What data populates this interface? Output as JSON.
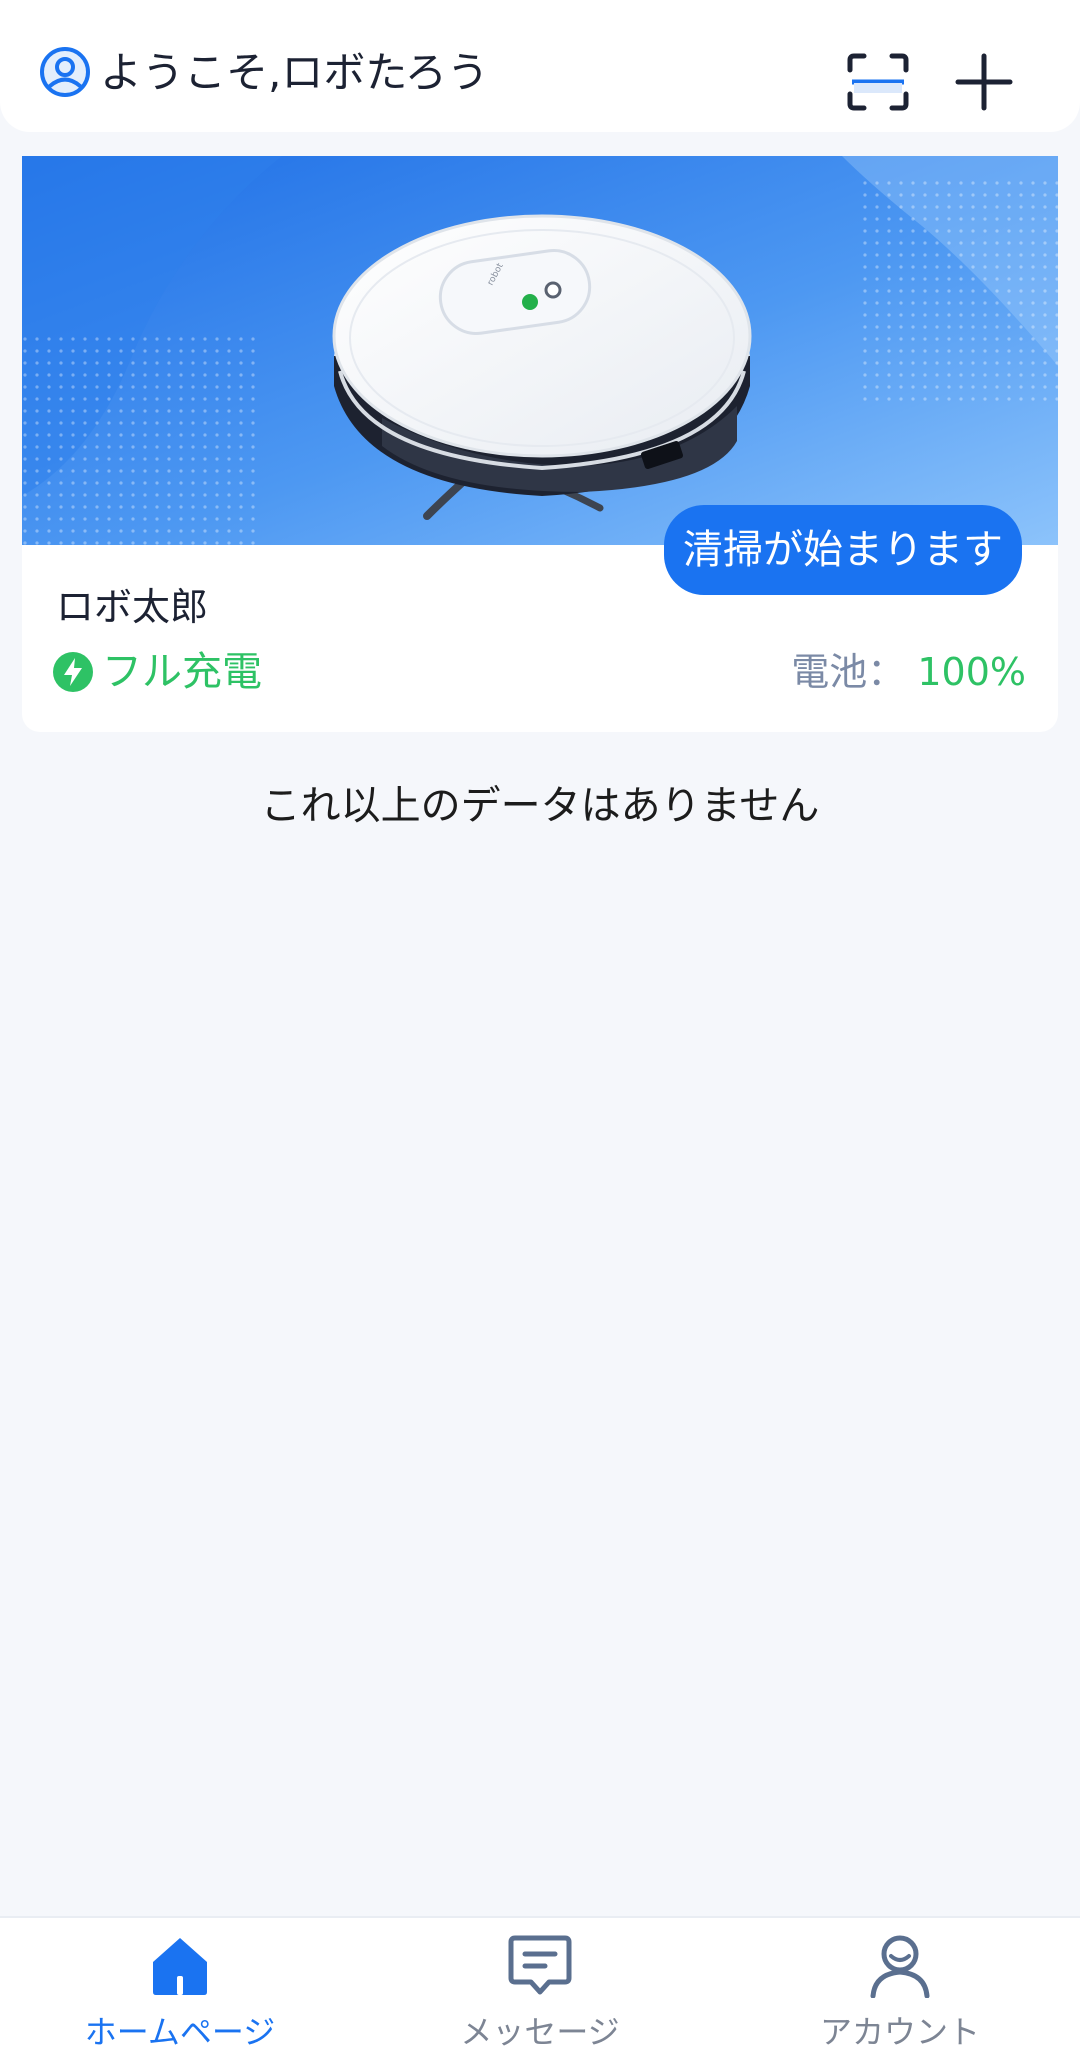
{
  "header": {
    "welcome_text": "ようこそ,ロボたろう",
    "icons": [
      "user-circle-icon",
      "scan-icon",
      "plus-icon"
    ]
  },
  "device": {
    "name": "ロボ太郎",
    "start_button_label": "清掃が始まります",
    "charge_status": "フル充電",
    "battery_label": "電池：",
    "battery_value": "100%"
  },
  "list_footer": "これ以上のデータはありません",
  "tabs": [
    {
      "label": "ホームページ",
      "icon": "home-icon",
      "active": true
    },
    {
      "label": "メッセージ",
      "icon": "message-icon",
      "active": false
    },
    {
      "label": "アカウント",
      "icon": "account-icon",
      "active": false
    }
  ],
  "colors": {
    "accent": "#1a73f1",
    "success": "#2ec265",
    "muted": "#7d8594",
    "background": "#f5f7fb"
  }
}
